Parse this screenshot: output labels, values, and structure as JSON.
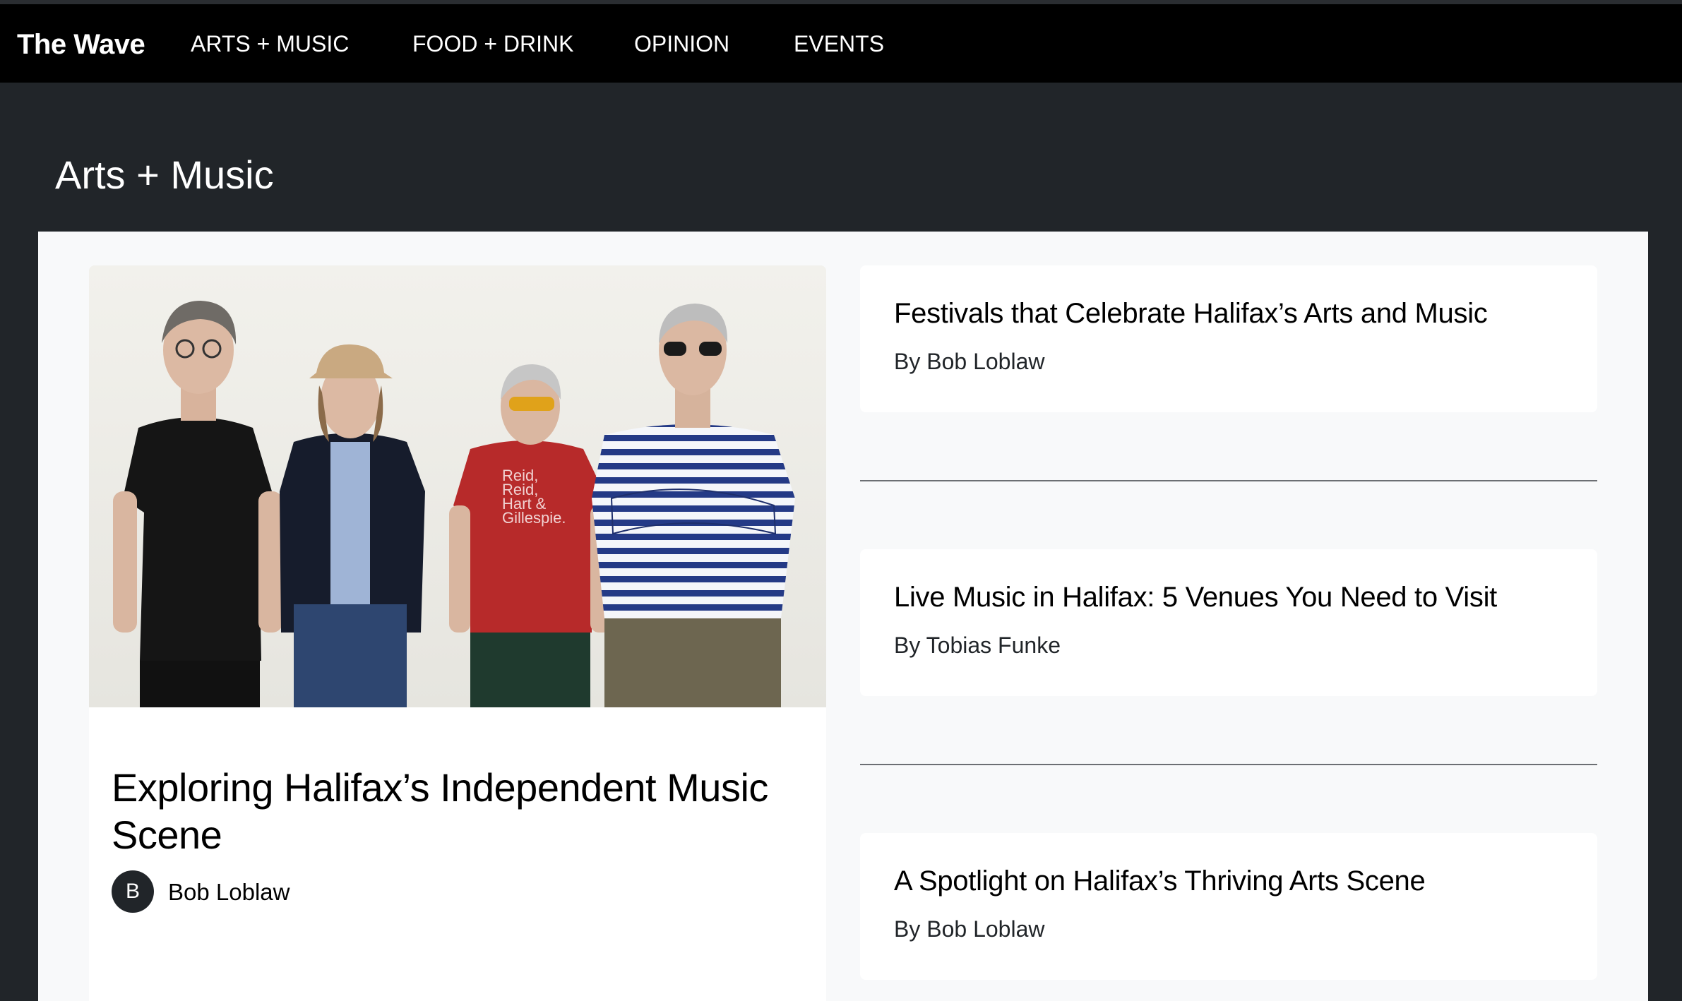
{
  "nav": {
    "brand": "The Wave",
    "links": [
      {
        "label": "ARTS + MUSIC"
      },
      {
        "label": "FOOD + DRINK"
      },
      {
        "label": "OPINION"
      },
      {
        "label": "EVENTS"
      }
    ]
  },
  "page": {
    "heading": "Arts + Music"
  },
  "feature": {
    "title": "Exploring Halifax’s Independent Music Scene",
    "author_initial": "B",
    "author": "Bob Loblaw",
    "shirt_text": [
      "Reid,",
      "Reid,",
      "Hart &",
      "Gillespie."
    ]
  },
  "stories": [
    {
      "title": "Festivals that Celebrate Halifax’s Arts and Music",
      "byline": "By Bob Loblaw"
    },
    {
      "title": "Live Music in Halifax: 5 Venues You Need to Visit",
      "byline": "By Tobias Funke"
    },
    {
      "title": "A Spotlight on Halifax’s Thriving Arts Scene",
      "byline": "By Bob Loblaw"
    }
  ],
  "colors": {
    "navbar": "#000000",
    "page_background": "#212529",
    "panel": "#f8f9fa",
    "card": "#ffffff"
  }
}
